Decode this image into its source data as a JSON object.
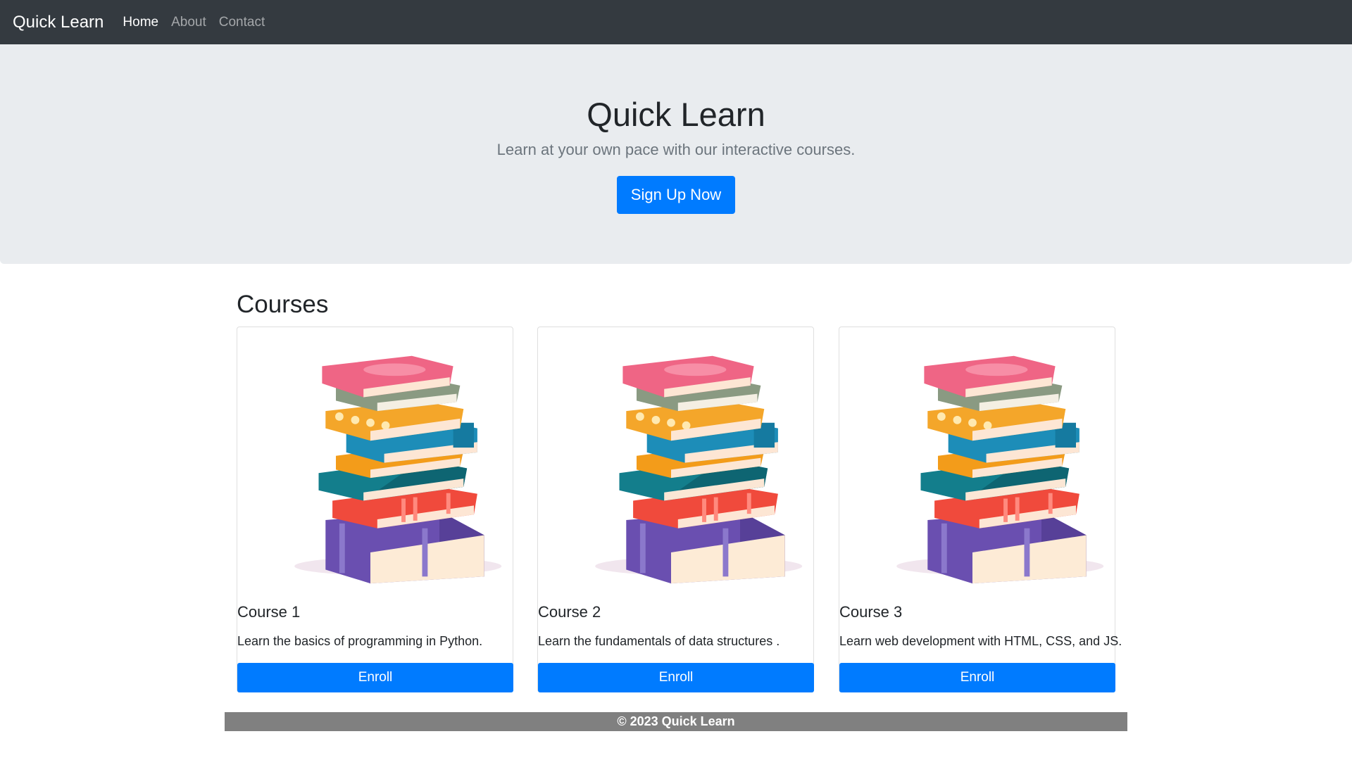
{
  "navbar": {
    "brand": "Quick Learn",
    "links": [
      {
        "label": "Home",
        "active": true
      },
      {
        "label": "About",
        "active": false
      },
      {
        "label": "Contact",
        "active": false
      }
    ]
  },
  "hero": {
    "title": "Quick Learn",
    "subtitle": "Learn at your own pace with our interactive courses.",
    "cta_label": "Sign Up Now"
  },
  "courses": {
    "heading": "Courses",
    "items": [
      {
        "title": "Course 1",
        "description": "Learn the basics of programming in Python.",
        "button": "Enroll",
        "image": "book-stack-illustration"
      },
      {
        "title": "Course 2",
        "description": "Learn the fundamentals of data structures .",
        "button": "Enroll",
        "image": "book-stack-illustration"
      },
      {
        "title": "Course 3",
        "description": "Learn web development with HTML, CSS, and JS.",
        "button": "Enroll",
        "image": "book-stack-illustration"
      }
    ]
  },
  "footer": {
    "text": "© 2023 Quick Learn"
  },
  "colors": {
    "navbar_bg": "#343a40",
    "hero_bg": "#e9ecef",
    "primary": "#007bff",
    "footer_bg": "#808080"
  }
}
